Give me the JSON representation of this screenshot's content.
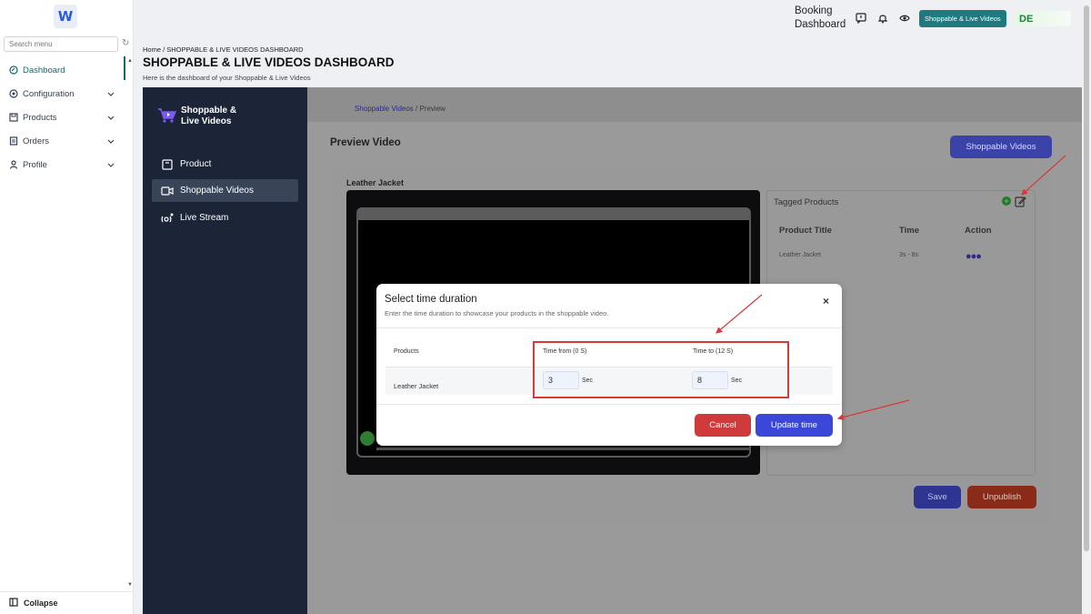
{
  "sidebar": {
    "logo_text": "W",
    "search_placeholder": "Search menu",
    "items": [
      {
        "label": "Dashboard",
        "icon": "dashboard-icon",
        "active": true
      },
      {
        "label": "Configuration",
        "icon": "gear-icon"
      },
      {
        "label": "Products",
        "icon": "box-icon"
      },
      {
        "label": "Orders",
        "icon": "orders-icon"
      },
      {
        "label": "Profile",
        "icon": "user-icon"
      }
    ],
    "collapse_label": "Collapse"
  },
  "topbar": {
    "booking_label": "Booking Dashboard",
    "button_label": "Shoppable & Live Videos",
    "avatar_text": "DE"
  },
  "page": {
    "breadcrumb": "Home / SHOPPABLE & LIVE VIDEOS DASHBOARD",
    "title": "SHOPPABLE & LIVE VIDEOS DASHBOARD",
    "subtitle": "Here is the dashboard of your Shoppable & Live Videos"
  },
  "app": {
    "brand_line1": "Shoppable &",
    "brand_line2": "Live Videos",
    "nav": [
      {
        "label": "Product",
        "icon": "product-icon"
      },
      {
        "label": "Shoppable Videos",
        "icon": "video-icon",
        "active": true
      },
      {
        "label": "Live Stream",
        "icon": "live-stream-icon"
      }
    ],
    "breadcrumb_link": "Shoppable Videos",
    "breadcrumb_sep": " / ",
    "breadcrumb_current": "Preview",
    "preview_title": "Preview Video",
    "shoppable_videos_button": "Shoppable Videos",
    "video_label": "Leather Jacket",
    "tagged": {
      "title": "Tagged Products",
      "columns": [
        "Product Title",
        "Time",
        "Action"
      ],
      "rows": [
        {
          "title": "Leather Jacket",
          "time": "3s - 8s"
        }
      ]
    },
    "save_label": "Save",
    "unpublish_label": "Unpublish"
  },
  "modal": {
    "title": "Select time duration",
    "subtitle": "Enter the time duration to showcase your products in the shoppable video.",
    "close": "×",
    "columns": [
      "Products",
      "Time from (0 S)",
      "Time to (12 S)"
    ],
    "row": {
      "product": "Leather Jacket",
      "time_from": "3",
      "time_to": "8",
      "unit": "Sec"
    },
    "cancel_label": "Cancel",
    "update_label": "Update time"
  },
  "colors": {
    "accent_teal": "#1f7a80",
    "primary_blue": "#3b47d9",
    "danger_red": "#cf3a3a",
    "annotation_red": "#d63a3a"
  }
}
